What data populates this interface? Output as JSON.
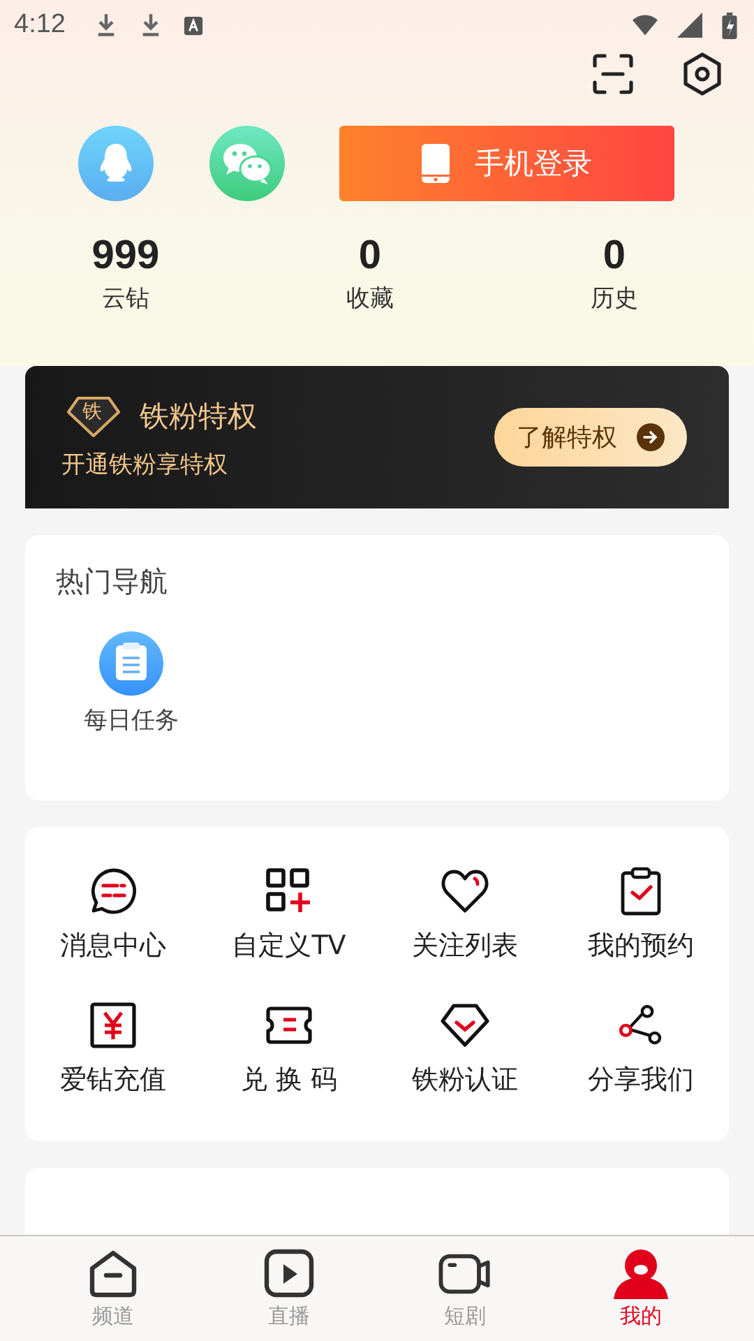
{
  "status_bar": {
    "time": "4:12"
  },
  "login": {
    "button": "手机登录"
  },
  "stats": [
    {
      "value": "999",
      "label": "云钻"
    },
    {
      "value": "0",
      "label": "收藏"
    },
    {
      "value": "0",
      "label": "历史"
    }
  ],
  "vip": {
    "badge": "铁",
    "title": "铁粉特权",
    "subtitle": "开通铁粉享特权",
    "button": "了解特权"
  },
  "hot_nav": {
    "title": "热门导航",
    "items": [
      {
        "label": "每日任务"
      }
    ]
  },
  "services": [
    {
      "kind": "message",
      "label": "消息中心"
    },
    {
      "kind": "custom",
      "label": "自定义TV"
    },
    {
      "kind": "follow",
      "label": "关注列表"
    },
    {
      "kind": "booking",
      "label": "我的预约"
    },
    {
      "kind": "recharge",
      "label": "爱钻充值"
    },
    {
      "kind": "code",
      "label": "兑 换 码"
    },
    {
      "kind": "fan",
      "label": "铁粉认证"
    },
    {
      "kind": "share",
      "label": "分享我们"
    }
  ],
  "tab_bar": [
    {
      "kind": "channel",
      "label": "频道",
      "selected": false
    },
    {
      "kind": "live",
      "label": "直播",
      "selected": false
    },
    {
      "kind": "drama",
      "label": "短剧",
      "selected": false
    },
    {
      "kind": "mine",
      "label": "我的",
      "selected": true
    }
  ]
}
